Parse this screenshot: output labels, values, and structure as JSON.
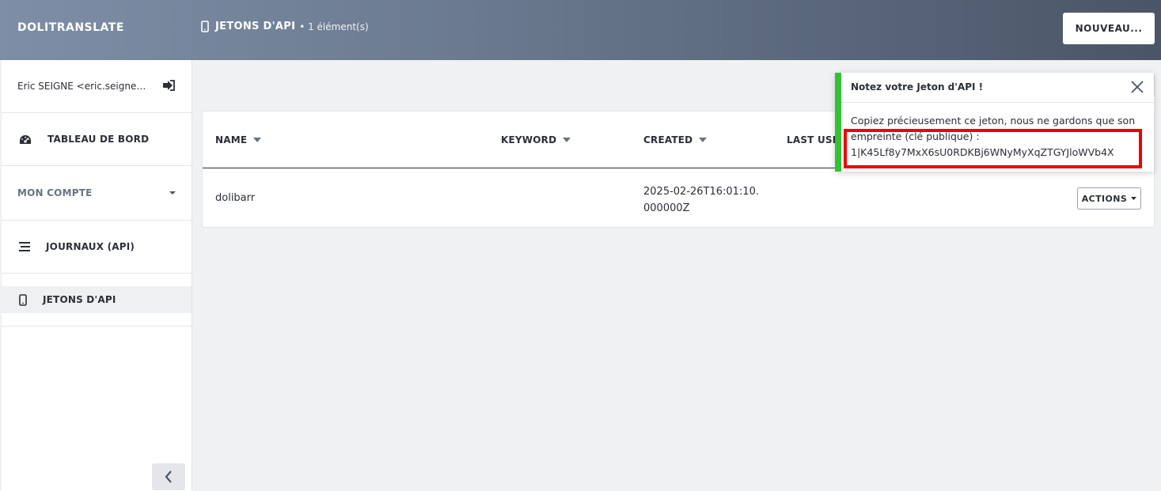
{
  "header": {
    "app_name": "DOLITRANSLATE",
    "page_title": "JETONS D'API",
    "page_count": "• 1 élément(s)",
    "new_button": "NOUVEAU..."
  },
  "sidebar": {
    "user": "Eric SEIGNE <eric.seigne@...",
    "items": [
      {
        "label": "TABLEAU DE BORD",
        "icon": "gauge-icon"
      },
      {
        "label": "MON COMPTE",
        "icon": "chevron-down-icon"
      },
      {
        "label": "JOURNAUX (API)",
        "icon": "list-icon"
      },
      {
        "label": "JETONS D'API",
        "icon": "mobile-icon",
        "active": true
      }
    ]
  },
  "table": {
    "columns": [
      "NAME",
      "KEYWORD",
      "CREATED",
      "LAST USED"
    ],
    "rows": [
      {
        "name": "dolibarr",
        "keyword": "",
        "created": "2025-02-26T16:01:10.000000Z",
        "actions_label": "ACTIONS"
      }
    ]
  },
  "notification": {
    "title": "Notez votre Jeton d'API !",
    "message": "Copiez précieusement ce jeton, nous ne gardons que son empreinte (clé publique) : 1|K45Lf8y7MxX6sU0RDKBj6WNyMyXqZTGYJloWVb4X",
    "accent_color": "#33c234",
    "highlight_color": "#ee0000"
  }
}
